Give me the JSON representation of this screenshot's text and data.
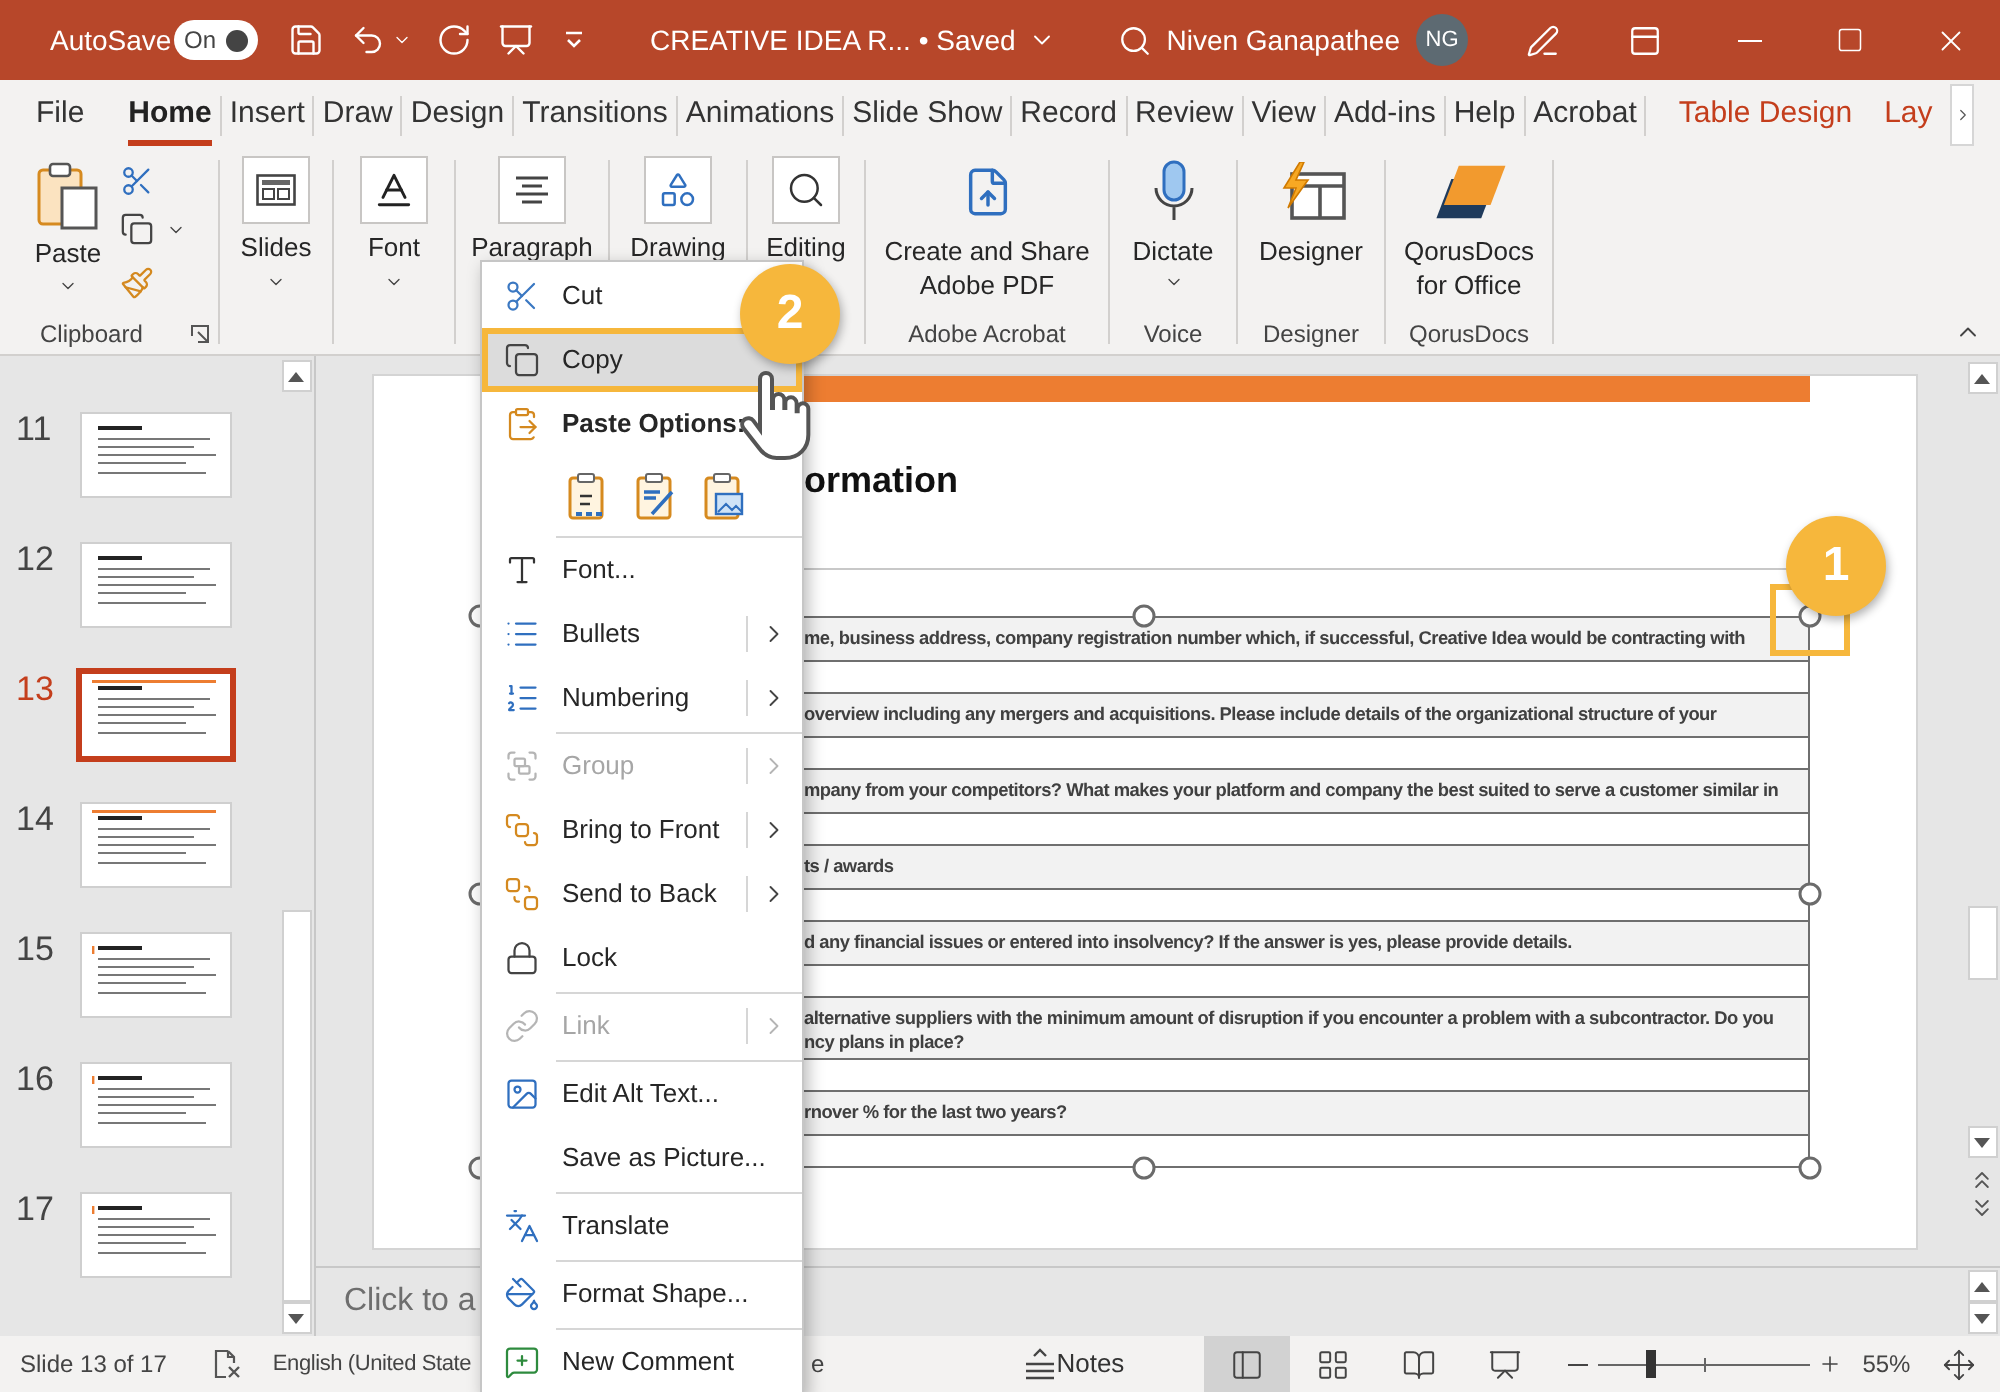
{
  "title_bar": {
    "autosave_label": "AutoSave",
    "autosave": {
      "on": true,
      "label": "On"
    },
    "document_title": "CREATIVE IDEA R... • Saved",
    "user_name": "Niven Ganapathee",
    "user_initials": "NG"
  },
  "ribbon_tabs": [
    {
      "label": "File",
      "kind": "standard",
      "selected": false
    },
    {
      "label": "Home",
      "kind": "standard",
      "selected": true
    },
    {
      "label": "Insert",
      "kind": "standard",
      "selected": false
    },
    {
      "label": "Draw",
      "kind": "standard",
      "selected": false
    },
    {
      "label": "Design",
      "kind": "standard",
      "selected": false
    },
    {
      "label": "Transitions",
      "kind": "standard",
      "selected": false
    },
    {
      "label": "Animations",
      "kind": "standard",
      "selected": false
    },
    {
      "label": "Slide Show",
      "kind": "standard",
      "selected": false
    },
    {
      "label": "Record",
      "kind": "standard",
      "selected": false
    },
    {
      "label": "Review",
      "kind": "standard",
      "selected": false
    },
    {
      "label": "View",
      "kind": "standard",
      "selected": false
    },
    {
      "label": "Add-ins",
      "kind": "standard",
      "selected": false
    },
    {
      "label": "Help",
      "kind": "standard",
      "selected": false
    },
    {
      "label": "Acrobat",
      "kind": "standard",
      "selected": false
    },
    {
      "label": "Table Design",
      "kind": "contextual",
      "selected": false
    },
    {
      "label": "Lay",
      "kind": "contextual",
      "selected": false
    }
  ],
  "ribbon": {
    "clipboard": {
      "paste": "Paste",
      "label": "Clipboard"
    },
    "collapsed_groups": [
      {
        "label": "Slides",
        "has_menu": true
      },
      {
        "label": "Font",
        "has_menu": true
      },
      {
        "label": "Paragraph",
        "has_menu": false
      },
      {
        "label": "Drawing",
        "has_menu": false
      },
      {
        "label": "Editing",
        "has_menu": false
      }
    ],
    "groups": [
      {
        "button": "Create and Share Adobe PDF",
        "label": "Adobe Acrobat",
        "has_menu": false
      },
      {
        "button": "Dictate",
        "label": "Voice",
        "has_menu": true
      },
      {
        "button": "Designer",
        "label": "Designer",
        "has_menu": false
      },
      {
        "button": "QorusDocs for Office",
        "label": "QorusDocs",
        "has_menu": false
      }
    ]
  },
  "slides": [
    {
      "number": "11",
      "selected": false
    },
    {
      "number": "12",
      "selected": false
    },
    {
      "number": "13",
      "selected": true
    },
    {
      "number": "14",
      "selected": false
    },
    {
      "number": "15",
      "selected": false
    },
    {
      "number": "16",
      "selected": false
    },
    {
      "number": "17",
      "selected": false
    }
  ],
  "slide": {
    "title": "ormation",
    "rows": [
      {
        "lines": [
          "me, business address, company registration number which, if successful, Creative Idea would be contracting with"
        ]
      },
      {
        "lines": [
          "overview including any mergers and acquisitions. Please include details of the organizational structure of your"
        ]
      },
      {
        "lines": [
          "mpany from your competitors? What makes your platform and company the best suited to serve a customer similar in"
        ]
      },
      {
        "lines": [
          "ts / awards"
        ]
      },
      {
        "lines": [
          "d any financial issues or entered into insolvency? If the answer is yes, please provide details."
        ]
      },
      {
        "lines": [
          "alternative suppliers with the minimum amount of disruption if you encounter a problem with a subcontractor. Do you",
          "ncy plans in place?"
        ]
      },
      {
        "lines": [
          "rnover % for the last two years?"
        ]
      }
    ]
  },
  "notes": {
    "placeholder": "Click to a"
  },
  "status_bar": {
    "slide_info": "Slide 13 of 17",
    "language": "English (United State",
    "fragment": "e",
    "notes_label": "Notes",
    "views": [
      {
        "selected": true
      },
      {
        "selected": false
      },
      {
        "selected": false
      },
      {
        "selected": false
      }
    ],
    "zoom": {
      "level": 0.24,
      "reading": "55%"
    }
  },
  "context_menu": [
    {
      "kind": "item",
      "label": "Cut",
      "selected": false,
      "disabled": false,
      "submenu": false,
      "highlighted": false
    },
    {
      "kind": "item",
      "label": "Copy",
      "selected": true,
      "disabled": false,
      "submenu": false,
      "highlighted": true
    },
    {
      "kind": "heading",
      "label": "Paste Options:"
    },
    {
      "kind": "paste_options"
    },
    {
      "kind": "separator"
    },
    {
      "kind": "item",
      "label": "Font...",
      "selected": false,
      "disabled": false,
      "submenu": false,
      "highlighted": false
    },
    {
      "kind": "item",
      "label": "Bullets",
      "selected": false,
      "disabled": false,
      "submenu": true,
      "highlighted": false
    },
    {
      "kind": "item",
      "label": "Numbering",
      "selected": false,
      "disabled": false,
      "submenu": true,
      "highlighted": false
    },
    {
      "kind": "separator"
    },
    {
      "kind": "item",
      "label": "Group",
      "selected": false,
      "disabled": true,
      "submenu": true,
      "highlighted": false
    },
    {
      "kind": "item",
      "label": "Bring to Front",
      "selected": false,
      "disabled": false,
      "submenu": true,
      "highlighted": false
    },
    {
      "kind": "item",
      "label": "Send to Back",
      "selected": false,
      "disabled": false,
      "submenu": true,
      "highlighted": false
    },
    {
      "kind": "item",
      "label": "Lock",
      "selected": false,
      "disabled": false,
      "submenu": false,
      "highlighted": false
    },
    {
      "kind": "separator"
    },
    {
      "kind": "item",
      "label": "Link",
      "selected": false,
      "disabled": true,
      "submenu": true,
      "highlighted": false
    },
    {
      "kind": "separator"
    },
    {
      "kind": "item",
      "label": "Edit Alt Text...",
      "selected": false,
      "disabled": false,
      "submenu": false,
      "highlighted": false
    },
    {
      "kind": "item",
      "label": "Save as Picture...",
      "selected": false,
      "disabled": false,
      "submenu": false,
      "highlighted": false
    },
    {
      "kind": "separator"
    },
    {
      "kind": "item",
      "label": "Translate",
      "selected": false,
      "disabled": false,
      "submenu": false,
      "highlighted": false
    },
    {
      "kind": "separator"
    },
    {
      "kind": "item",
      "label": "Format Shape...",
      "selected": false,
      "disabled": false,
      "submenu": false,
      "highlighted": false
    },
    {
      "kind": "separator"
    },
    {
      "kind": "item",
      "label": "New Comment",
      "selected": false,
      "disabled": false,
      "submenu": false,
      "highlighted": false
    }
  ],
  "callouts": [
    {
      "label": "1"
    },
    {
      "label": "2"
    }
  ]
}
